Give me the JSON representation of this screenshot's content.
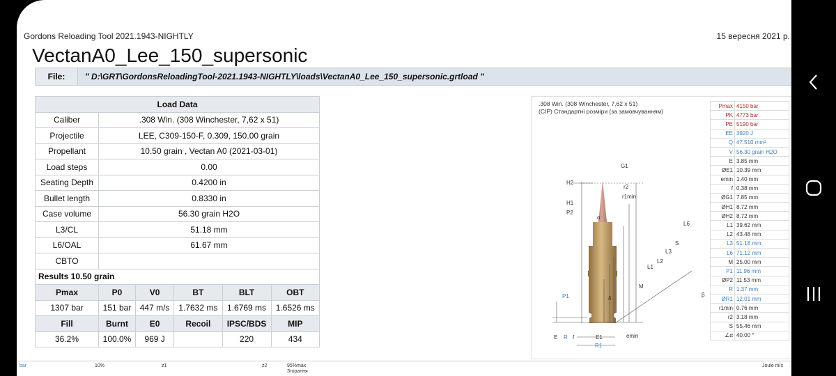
{
  "header": {
    "app": "Gordons Reloading Tool 2021.1943-NIGHTLY",
    "date": "15 вересня 2021 р."
  },
  "title": "VectanA0_Lee_150_supersonic",
  "file": {
    "label": "File:",
    "path": "\" D:\\GRT\\GordonsReloadingTool-2021.1943-NIGHTLY\\loads\\VectanA0_Lee_150_supersonic.grtload     \""
  },
  "load": {
    "heading": "Load  Data",
    "rows": [
      {
        "k": "Caliber",
        "v": ".308  Win. (308 Winchester,  7,62  x 51)"
      },
      {
        "k": "Projectile",
        "v": "LEE, C309-150-F,   0.309,  150.00  grain"
      },
      {
        "k": "Propellant",
        "v": "10.50  grain , Vectan  A0 (2021-03-01)"
      },
      {
        "k": "Load steps",
        "v": "0.00"
      },
      {
        "k": "Seating Depth",
        "v": "0.4200   in"
      },
      {
        "k": "Bullet length",
        "v": "0.8330   in"
      },
      {
        "k": "Case volume",
        "v": "56.30  grain H2O"
      },
      {
        "k": "L3/CL",
        "v": "51.18  mm"
      },
      {
        "k": "L6/OAL",
        "v": "61.67  mm"
      },
      {
        "k": "CBTO",
        "v": ""
      }
    ],
    "results_title": "Results 10.50 grain",
    "res_h1": [
      "Pmax",
      "P0",
      "V0",
      "BT",
      "BLT",
      "OBT"
    ],
    "res_v1": [
      "1307  bar",
      "151  bar",
      "447  m/s",
      "1.7632  ms",
      "1.6769  ms",
      "1.6526  ms"
    ],
    "res_h2": [
      "Fill",
      "Burnt",
      "E0",
      "Recoil",
      "IPSC/BDS",
      "MIP"
    ],
    "res_v2": [
      "36.2%",
      "100.0%",
      "969  J",
      "",
      "220",
      "434"
    ]
  },
  "diagram": {
    "caption1": ".308 Win. (308 Winchester, 7,62 x 51)",
    "caption2": "(CIP) Стандартні розміри (за замовчуванням)",
    "labels": {
      "G1": "G1",
      "H2": "H2",
      "r2": "r2",
      "r1min": "r1min",
      "H1": "H1",
      "P2": "P2",
      "alpha": "α",
      "L6": "L6",
      "S": "S",
      "L3": "L3",
      "L2": "L2",
      "L1": "L1",
      "M": "M",
      "beta": "β",
      "delta": "δ",
      "P1": "P1",
      "E": "E",
      "R": "R",
      "f": "f",
      "E1": "E1",
      "R1": "R1",
      "emin": "emin"
    },
    "params": [
      {
        "k": "Pmax",
        "v": "4150 bar",
        "c": "#b03030"
      },
      {
        "k": "PK",
        "v": "4773 bar",
        "c": "#b03030"
      },
      {
        "k": "PE",
        "v": "5190 bar",
        "c": "#b03030"
      },
      {
        "k": "EE",
        "v": "3920 J",
        "c": "#3a7fc0"
      },
      {
        "k": "Q",
        "v": "47.510 mm²",
        "c": "#3a7fc0"
      },
      {
        "k": "V",
        "v": "56.30 grain H2O",
        "c": "#3a7fc0"
      },
      {
        "k": "E",
        "v": "3.85 mm",
        "c": "#333333"
      },
      {
        "k": "ØE1",
        "v": "10.39 mm",
        "c": "#333333"
      },
      {
        "k": "emin",
        "v": "1.40 mm",
        "c": "#333333"
      },
      {
        "k": "f",
        "v": "0.38 mm",
        "c": "#333333"
      },
      {
        "k": "ØG1",
        "v": "7.85 mm",
        "c": "#333333"
      },
      {
        "k": "ØH1",
        "v": "8.72 mm",
        "c": "#333333"
      },
      {
        "k": "ØH2",
        "v": "8.72 mm",
        "c": "#333333"
      },
      {
        "k": "L1",
        "v": "39.62 mm",
        "c": "#333333"
      },
      {
        "k": "L2",
        "v": "43.48 mm",
        "c": "#333333"
      },
      {
        "k": "L3",
        "v": "51.18 mm",
        "c": "#3a7fc0"
      },
      {
        "k": "L6",
        "v": "71.12 mm",
        "c": "#3a7fc0"
      },
      {
        "k": "M",
        "v": "25.00 mm",
        "c": "#333333"
      },
      {
        "k": "P1",
        "v": "11.96 mm",
        "c": "#3a7fc0"
      },
      {
        "k": "ØP2",
        "v": "11.53 mm",
        "c": "#333333"
      },
      {
        "k": "R",
        "v": "1.37 mm",
        "c": "#3a7fc0"
      },
      {
        "k": "ØR1",
        "v": "12.01 mm",
        "c": "#3a7fc0"
      },
      {
        "k": "r1min",
        "v": "0.76 mm",
        "c": "#333333"
      },
      {
        "k": "r2",
        "v": "3.18 mm",
        "c": "#333333"
      },
      {
        "k": "S",
        "v": "55.46 mm",
        "c": "#333333"
      },
      {
        "k": "∠α",
        "v": "40.00 °",
        "c": "#333333"
      }
    ]
  },
  "bottom": {
    "bar": "bar",
    "p10": "10%",
    "z1": "z1",
    "z2": "z2",
    "p95": "95%max",
    "p95b": "Згорання",
    "joule": "Joule  m/s"
  },
  "colors": {
    "case_brass": "#c4a06a",
    "bullet_copper": "#b07866",
    "dim_blue": "#3a7fc0"
  }
}
